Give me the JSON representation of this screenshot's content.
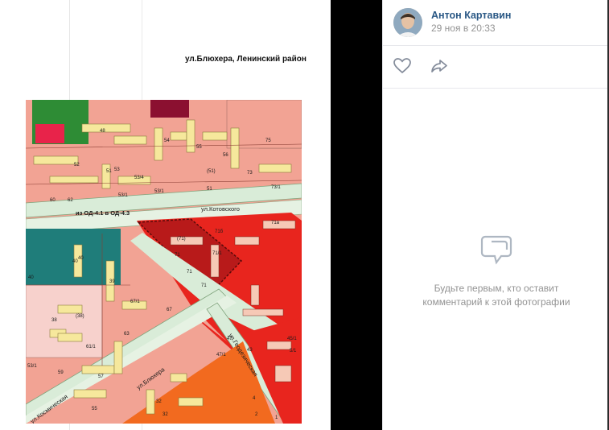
{
  "photo": {
    "document_title": "ул.Блюхера, Ленинский район",
    "map": {
      "zone_label": "из ОД-4.1 в ОД-4.3",
      "streets": [
        "ул.Котовского",
        "ул.Блюхера",
        "ул.Геодезическая",
        "ул.Космическая"
      ],
      "building_numbers": [
        "48",
        "52",
        "52",
        "51",
        "53",
        "53/4",
        "53/4",
        "60",
        "62",
        "53/1",
        "51",
        "59",
        "55",
        "75",
        "73",
        "73/1",
        "(51)",
        "51",
        "40",
        "40",
        "40",
        "38",
        "38",
        "(38)",
        "39",
        "67/1",
        "67",
        "63",
        "61",
        "63",
        "59",
        "57",
        "55",
        "53/1",
        "32",
        "32",
        "28",
        "71",
        "71",
        "71",
        "71",
        "71/1",
        "71а",
        "71б",
        "(71)",
        "47",
        "47/1",
        "43",
        "45/1",
        "5/1",
        "4",
        "4",
        "2",
        "1"
      ]
    },
    "colors": {
      "residential_salmon": "#f2a394",
      "public_red": "#e8251e",
      "business_orange": "#f26a1f",
      "teal_zone": "#1f7d7a",
      "green_zone": "#2e8c35",
      "roads": "#d9ecd8",
      "buildings": "#f6e89c"
    }
  },
  "sidebar": {
    "author": "Антон Картавин",
    "date": "29 ноя в 20:33",
    "like_icon": "heart-icon",
    "share_icon": "share-arrow-icon",
    "empty_icon": "comments-icon",
    "empty_text": "Будьте первым, кто оставит комментарий к этой фотографии",
    "link_color": "#2a5885",
    "muted_color": "#939393"
  }
}
